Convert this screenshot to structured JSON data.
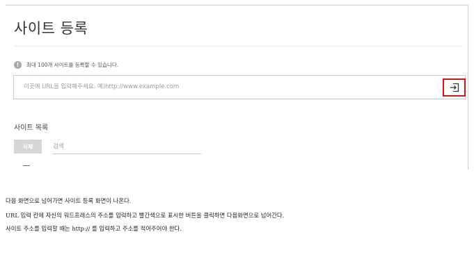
{
  "page": {
    "title": "사이트 등록",
    "notice": "최대 100개 사이트를 등록할 수 있습니다.",
    "url_input": {
      "placeholder": "이곳에 URL을 입력해주세요. 예)http://www.example.com",
      "value": ""
    },
    "submit_icon": "arrow-into-box-icon",
    "list_title": "사이트 목록",
    "delete_label": "삭제",
    "search": {
      "placeholder": "검색",
      "value": ""
    },
    "empty_indicator": "—",
    "highlight_color": "#e01010"
  },
  "captions": [
    "다음 화면으로 넘어가면 사이트 등록 화면이 나온다.",
    "URL 입력 칸에 자신의 워드프레스의 주소를 입력하고 빨간색으로 표시한 버튼을 클릭하면 다음화면으로 넘어간다.",
    "사이트 주소를 입력할 때는 http:// 를 입력하고 주소를 적어주어야 한다."
  ]
}
